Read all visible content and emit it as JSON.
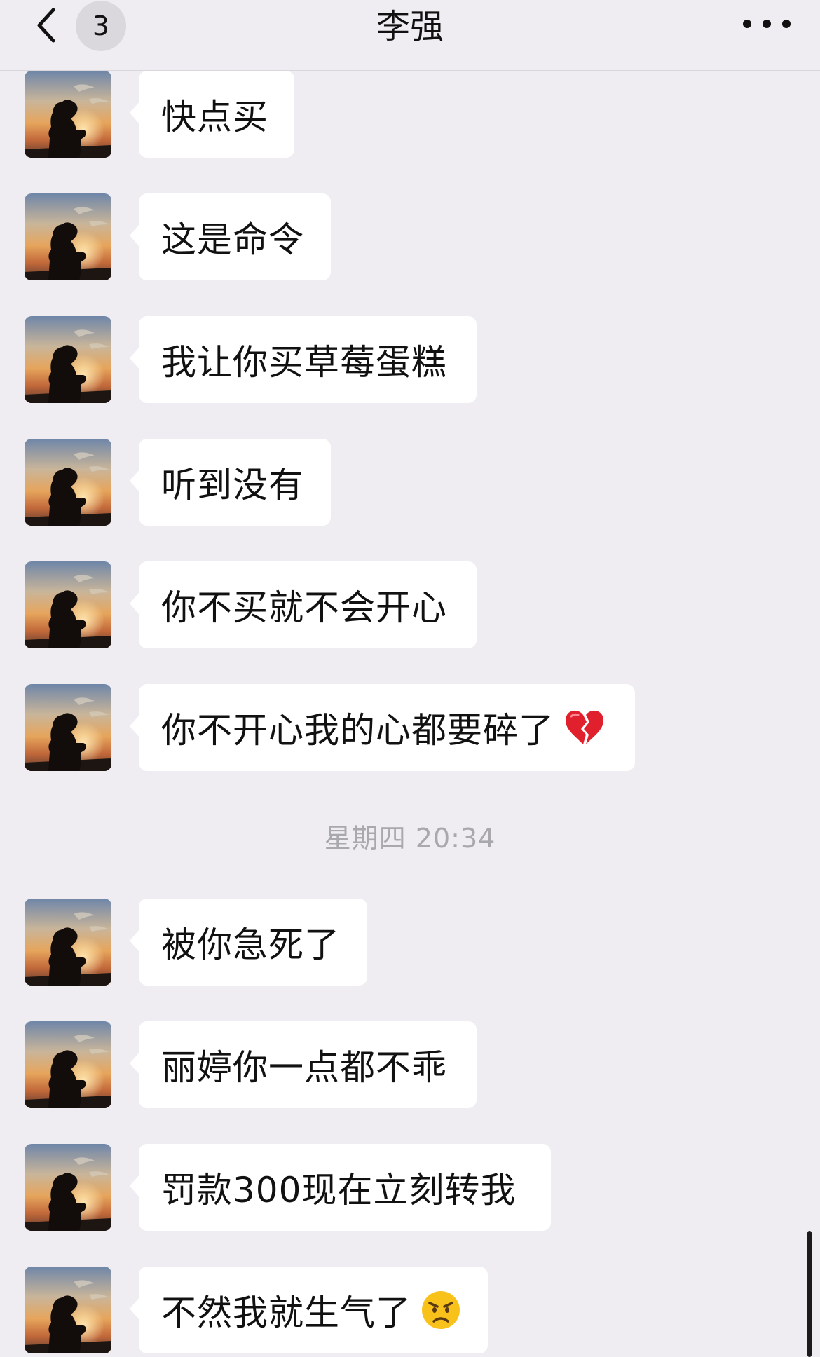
{
  "header": {
    "title": "李强",
    "badge_count": "3",
    "back_icon": "chevron-left-icon",
    "more_icon": "more-dots-icon"
  },
  "timestamp": "星期四 20:34",
  "messages": [
    {
      "text": "快点买"
    },
    {
      "text": "这是命令"
    },
    {
      "text": "我让你买草莓蛋糕"
    },
    {
      "text": "听到没有"
    },
    {
      "text": "你不买就不会开心"
    },
    {
      "text": "你不开心我的心都要碎了",
      "emoji": "broken-heart-icon"
    },
    {
      "text": "被你急死了"
    },
    {
      "text": "丽婷你一点都不乖"
    },
    {
      "text": "罚款300现在立刻转我"
    },
    {
      "text": "不然我就生气了",
      "emoji": "angry-face-icon"
    }
  ],
  "colors": {
    "background": "#efedf1",
    "bubble": "#ffffff",
    "timestamp": "#a9a8ad"
  }
}
